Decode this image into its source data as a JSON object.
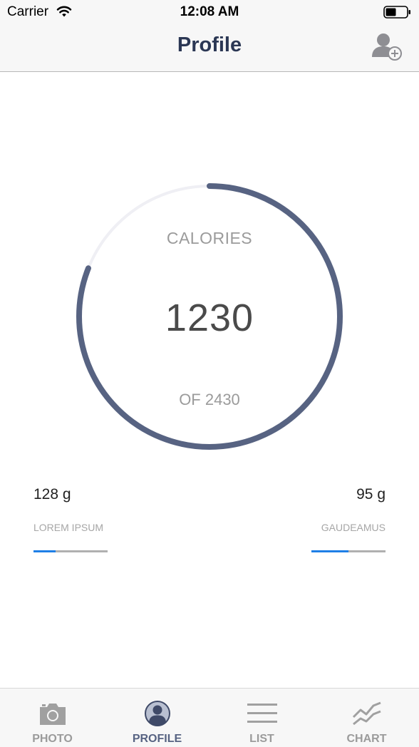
{
  "status_bar": {
    "carrier": "Carrier",
    "time": "12:08 AM",
    "wifi_icon": "wifi-icon",
    "battery_icon": "battery-icon"
  },
  "nav": {
    "title": "Profile",
    "action_icon": "add-user-icon"
  },
  "calories": {
    "label": "CALORIES",
    "value": "1230",
    "total_text": "OF 2430",
    "progress_fraction": 0.81
  },
  "stats": [
    {
      "value": "128 g",
      "label": "LOREM IPSUM",
      "progress_fraction": 0.3
    },
    {
      "value": "95 g",
      "label": "GAUDEAMUS",
      "progress_fraction": 0.5
    }
  ],
  "tabs": [
    {
      "label": "PHOTO",
      "icon": "camera-icon",
      "active": false
    },
    {
      "label": "PROFILE",
      "icon": "profile-icon",
      "active": true
    },
    {
      "label": "LIST",
      "icon": "list-icon",
      "active": false
    },
    {
      "label": "CHART",
      "icon": "chart-icon",
      "active": false
    }
  ],
  "colors": {
    "accent": "#576382",
    "ring_track": "#efeff4",
    "bar_fill": "#1f7fe6",
    "bar_track": "#b0b0b0"
  }
}
